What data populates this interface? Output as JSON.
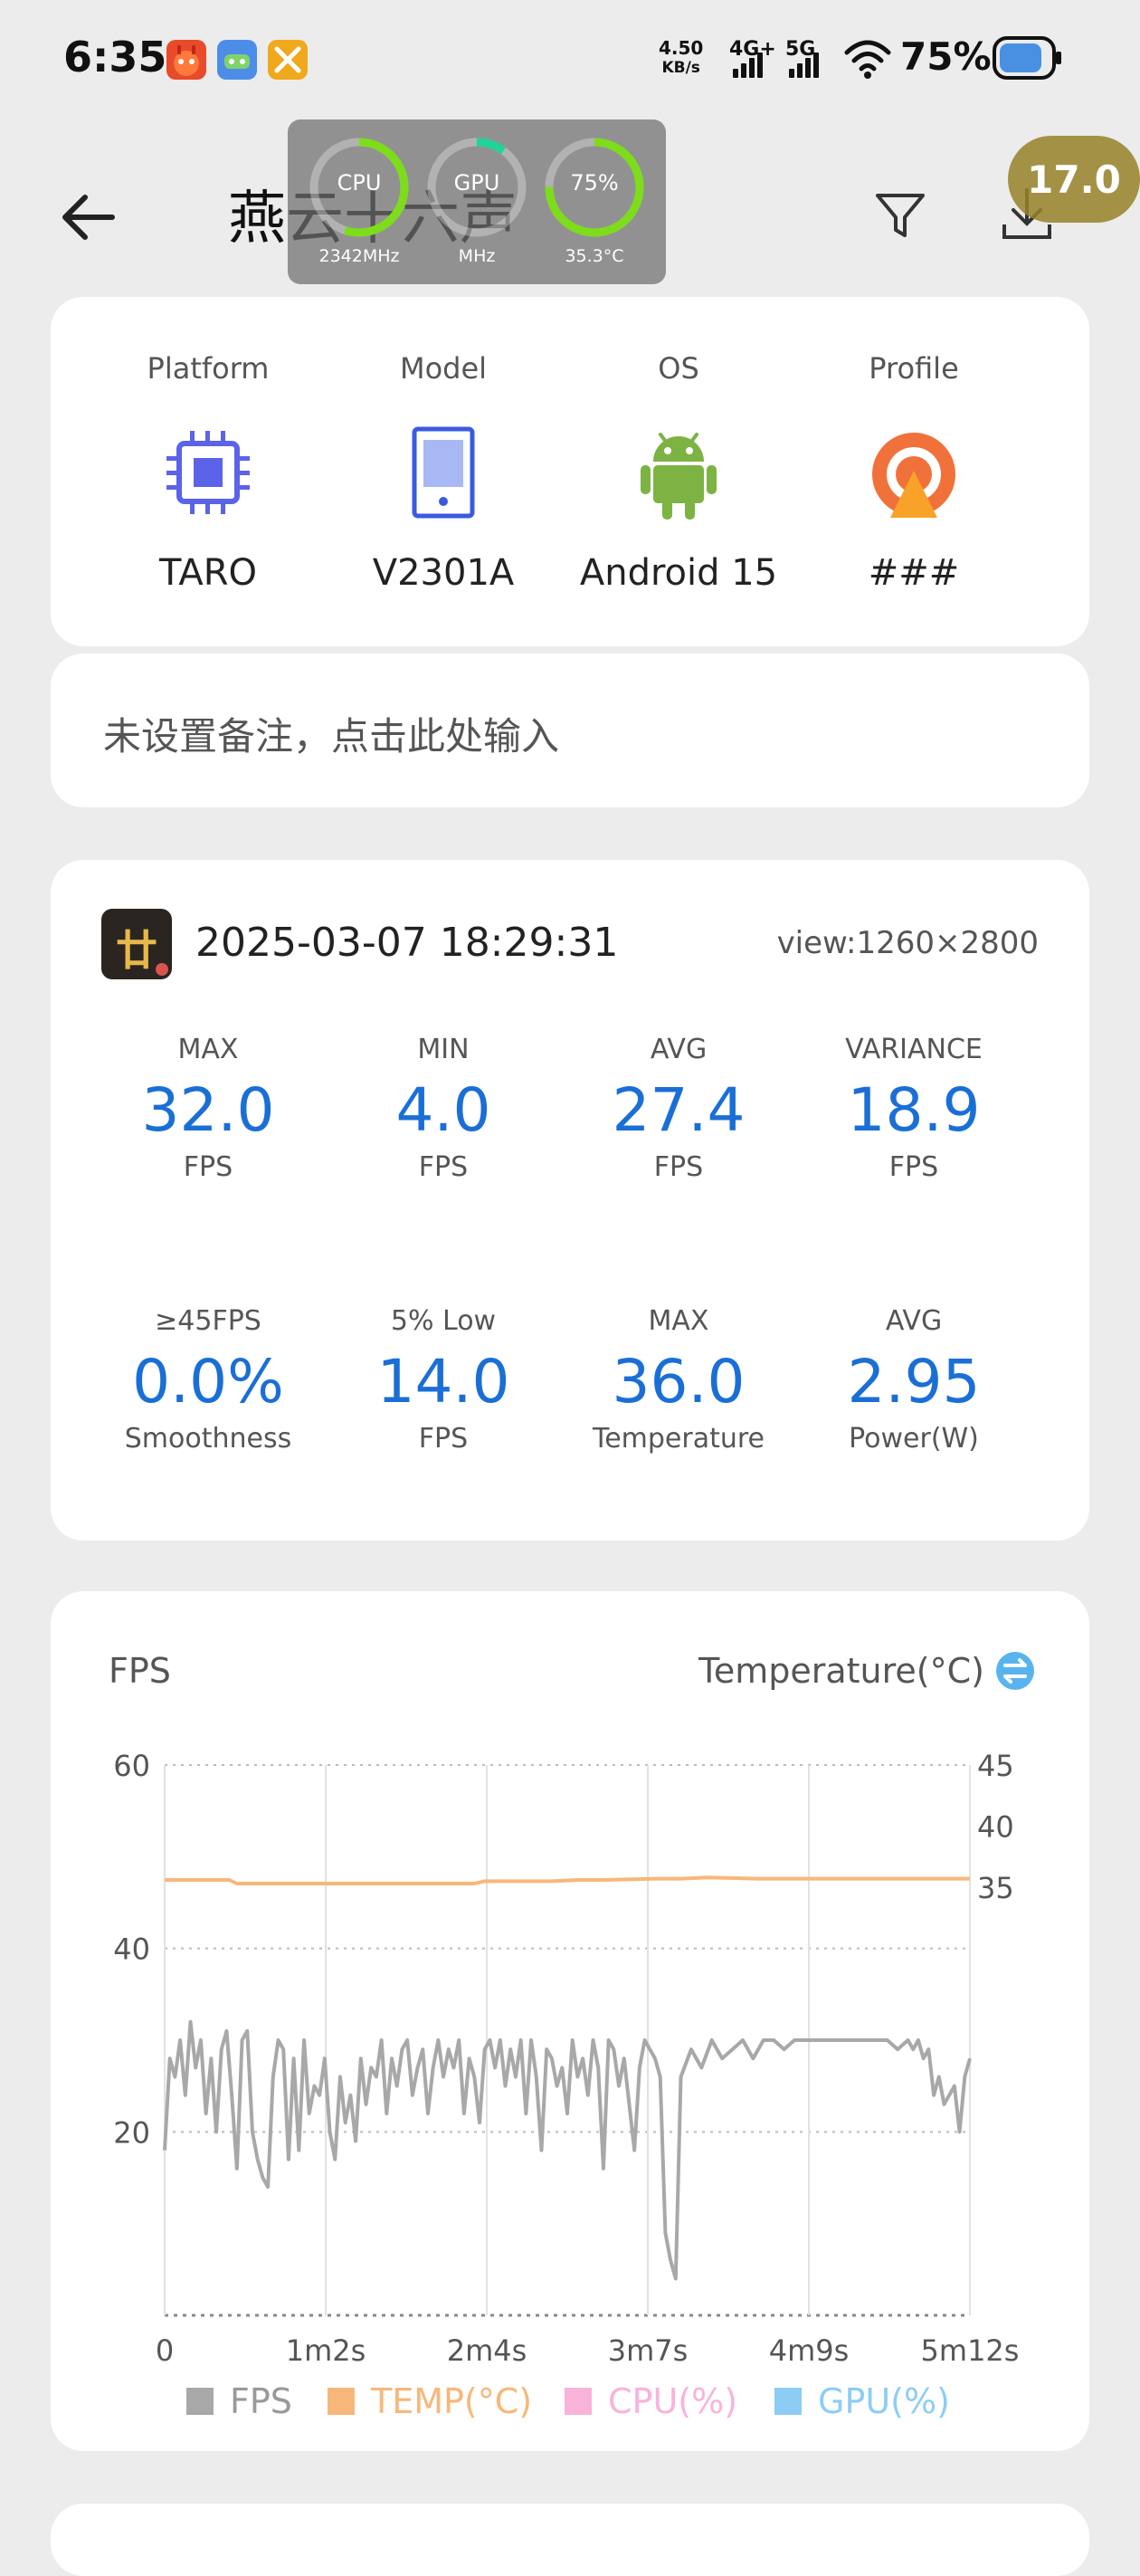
{
  "status_bar": {
    "time": "6:35",
    "net_speed_value": "4.50",
    "net_speed_unit": "KB/s",
    "sim1": "4G+",
    "sim2": "5G",
    "battery_percent": "75%",
    "battery_level": 0.75
  },
  "header": {
    "title": "燕云十六声",
    "back_icon": "back-arrow-icon",
    "filter_icon": "filter-icon",
    "download_icon": "download-icon",
    "fps_badge": "17.0"
  },
  "overlay": {
    "cpu_label": "CPU",
    "cpu_sub": "2342MHz",
    "cpu_level": 0.55,
    "gpu_label": "GPU",
    "gpu_sub": "MHz",
    "gpu_level": 0.1,
    "bat_label": "75%",
    "bat_sub": "35.3°C",
    "bat_level": 0.75
  },
  "device": {
    "items": [
      {
        "label": "Platform",
        "value": "TARO",
        "icon": "chip-icon"
      },
      {
        "label": "Model",
        "value": "V2301A",
        "icon": "phone-icon"
      },
      {
        "label": "OS",
        "value": "Android 15",
        "icon": "android-icon"
      },
      {
        "label": "Profile",
        "value": "###",
        "icon": "profile-icon"
      }
    ]
  },
  "note": {
    "placeholder": "未设置备注，点击此处输入"
  },
  "session": {
    "datetime": "2025-03-07 18:29:31",
    "view": "view:1260×2800",
    "stats_row1": [
      {
        "top": "MAX",
        "value": "32.0",
        "bottom": "FPS"
      },
      {
        "top": "MIN",
        "value": "4.0",
        "bottom": "FPS"
      },
      {
        "top": "AVG",
        "value": "27.4",
        "bottom": "FPS"
      },
      {
        "top": "VARIANCE",
        "value": "18.9",
        "bottom": "FPS"
      }
    ],
    "stats_row2": [
      {
        "top": "≥45FPS",
        "value": "0.0%",
        "bottom": "Smoothness"
      },
      {
        "top": "5% Low",
        "value": "14.0",
        "bottom": "FPS"
      },
      {
        "top": "MAX",
        "value": "36.0",
        "bottom": "Temperature"
      },
      {
        "top": "AVG",
        "value": "2.95",
        "bottom": "Power(W)"
      }
    ]
  },
  "chart_card": {
    "left_title": "FPS",
    "right_title": "Temperature(°C)",
    "swap_icon": "swap-icon"
  },
  "chart_data": {
    "type": "line",
    "x_ticks": [
      "0",
      "1m2s",
      "2m4s",
      "3m7s",
      "4m9s",
      "5m12s"
    ],
    "x_range_seconds": [
      0,
      312
    ],
    "y_left_ticks": [
      "60",
      "40",
      "20"
    ],
    "y_left_range": [
      0,
      60
    ],
    "y_right_ticks": [
      "45",
      "40",
      "35"
    ],
    "y_right_range": [
      0,
      45
    ],
    "grid": true,
    "legend_position": "bottom",
    "colors": {
      "fps": "#a8a8a8",
      "temp": "#f8b77a",
      "cpu": "#f9b3d9",
      "gpu": "#8dcdf5"
    },
    "legend": [
      "FPS",
      "TEMP(°C)",
      "CPU(%)",
      "GPU(%)"
    ],
    "series": [
      {
        "name": "FPS",
        "x": [
          0,
          2,
          4,
          6,
          8,
          10,
          12,
          14,
          16,
          18,
          20,
          22,
          24,
          26,
          28,
          30,
          32,
          34,
          36,
          38,
          40,
          42,
          44,
          46,
          48,
          50,
          52,
          54,
          56,
          58,
          60,
          62,
          64,
          66,
          68,
          70,
          72,
          74,
          76,
          78,
          80,
          82,
          84,
          86,
          88,
          90,
          92,
          94,
          96,
          98,
          100,
          102,
          104,
          106,
          108,
          110,
          112,
          114,
          116,
          118,
          120,
          122,
          124,
          126,
          128,
          130,
          132,
          134,
          136,
          138,
          140,
          142,
          144,
          146,
          148,
          150,
          152,
          154,
          156,
          158,
          160,
          162,
          164,
          166,
          168,
          170,
          172,
          174,
          176,
          178,
          180,
          182,
          184,
          186,
          188,
          190,
          192,
          194,
          196,
          198,
          200,
          204,
          208,
          212,
          216,
          220,
          224,
          228,
          232,
          236,
          240,
          244,
          248,
          252,
          256,
          260,
          264,
          268,
          272,
          276,
          280,
          284,
          288,
          290,
          292,
          294,
          296,
          298,
          300,
          302,
          304,
          306,
          308,
          310,
          312
        ],
        "y": [
          18,
          28,
          26,
          30,
          24,
          32,
          27,
          30,
          22,
          28,
          20,
          29,
          31,
          24,
          16,
          30,
          31,
          20,
          17,
          15,
          14,
          26,
          30,
          29,
          17,
          28,
          18,
          30,
          22,
          25,
          24,
          28,
          20,
          17,
          26,
          21,
          24,
          19,
          28,
          23,
          27,
          26,
          30,
          22,
          28,
          25,
          29,
          30,
          24,
          27,
          29,
          22,
          27,
          30,
          26,
          29,
          27,
          30,
          22,
          28,
          26,
          21,
          29,
          30,
          27,
          30,
          25,
          29,
          26,
          30,
          22,
          30,
          26,
          18,
          29,
          28,
          25,
          27,
          22,
          30,
          26,
          28,
          24,
          30,
          27,
          16,
          30,
          29,
          25,
          28,
          23,
          18,
          27,
          30,
          29,
          28,
          26,
          9,
          6,
          4,
          26,
          29,
          27,
          30,
          28,
          29,
          30,
          28,
          30,
          30,
          29,
          30,
          30,
          30,
          30,
          30,
          30,
          30,
          30,
          30,
          30,
          29,
          30,
          29,
          30,
          28,
          29,
          24,
          26,
          23,
          24,
          25,
          20,
          26,
          28
        ]
      },
      {
        "name": "TEMP(°C)",
        "x": [
          0,
          25,
          28,
          60,
          100,
          120,
          124,
          150,
          160,
          170,
          190,
          200,
          210,
          230,
          240,
          270,
          300,
          312
        ],
        "y": [
          35.6,
          35.6,
          35.3,
          35.3,
          35.3,
          35.3,
          35.5,
          35.5,
          35.6,
          35.6,
          35.7,
          35.7,
          35.8,
          35.7,
          35.7,
          35.7,
          35.7,
          35.7
        ]
      }
    ]
  }
}
